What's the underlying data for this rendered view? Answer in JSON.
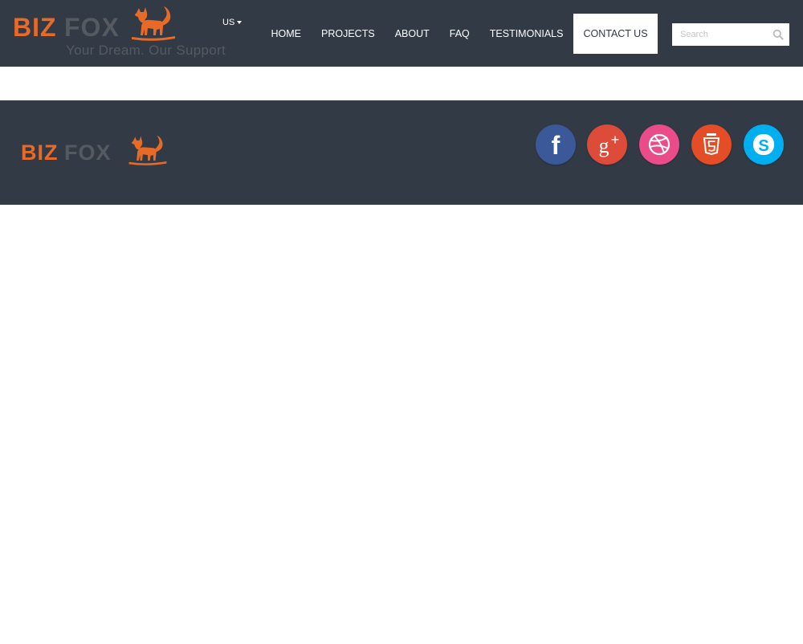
{
  "brand": {
    "name_part1": "BIZ",
    "name_part2": "FOX",
    "tagline": "Your Dream. Our Support",
    "colors": {
      "primary": "#e86a27",
      "secondary": "#555a60",
      "header_bg": "#323a46"
    }
  },
  "language": {
    "selected": "US"
  },
  "nav": {
    "items": [
      {
        "label": "HOME"
      },
      {
        "label": "PROJECTS"
      },
      {
        "label": "ABOUT"
      },
      {
        "label": "FAQ"
      },
      {
        "label": "TESTIMONIALS"
      },
      {
        "label": "CONTACT US",
        "active": true
      }
    ]
  },
  "search": {
    "placeholder": "Search",
    "icon": "search-icon"
  },
  "footer": {
    "social": [
      {
        "name": "facebook-icon",
        "color": "#3b5998"
      },
      {
        "name": "google-plus-icon",
        "color": "#dd4b39"
      },
      {
        "name": "dribbble-icon",
        "color": "#ea4c89"
      },
      {
        "name": "html5-icon",
        "color": "#e44d26"
      },
      {
        "name": "skype-icon",
        "color": "#00aff0"
      }
    ]
  }
}
